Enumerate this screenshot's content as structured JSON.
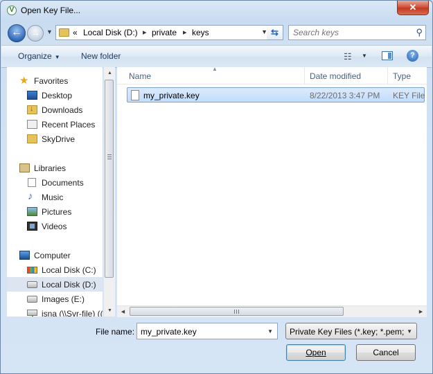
{
  "window": {
    "title": "Open Key File...",
    "close_label": "✕"
  },
  "nav": {
    "back_icon": "back-arrow-icon",
    "forward_icon": "forward-arrow-icon",
    "address": {
      "prefix": "«",
      "segments": [
        "Local Disk (D:)",
        "private",
        "keys"
      ],
      "separator": "▸"
    },
    "search_placeholder": "Search keys"
  },
  "toolbar": {
    "organize": "Organize",
    "new_folder": "New folder"
  },
  "sidebar": {
    "favorites": {
      "label": "Favorites",
      "items": [
        "Desktop",
        "Downloads",
        "Recent Places",
        "SkyDrive"
      ]
    },
    "libraries": {
      "label": "Libraries",
      "items": [
        "Documents",
        "Music",
        "Pictures",
        "Videos"
      ]
    },
    "computer": {
      "label": "Computer",
      "items": [
        "Local Disk (C:)",
        "Local Disk (D:)",
        "Images (E:)",
        "isna (\\\\Svr-file) (("
      ],
      "selected": "Local Disk (D:)"
    }
  },
  "file_list": {
    "columns": [
      "Name",
      "Date modified",
      "Type"
    ],
    "rows": [
      {
        "name": "my_private.key",
        "date": "8/22/2013 3:47 PM",
        "type": "KEY File"
      }
    ]
  },
  "footer": {
    "file_name_label": "File name:",
    "file_name_value": "my_private.key",
    "filter_value": "Private Key Files (*.key; *.pem; *",
    "open_label": "Open",
    "cancel_label": "Cancel"
  }
}
